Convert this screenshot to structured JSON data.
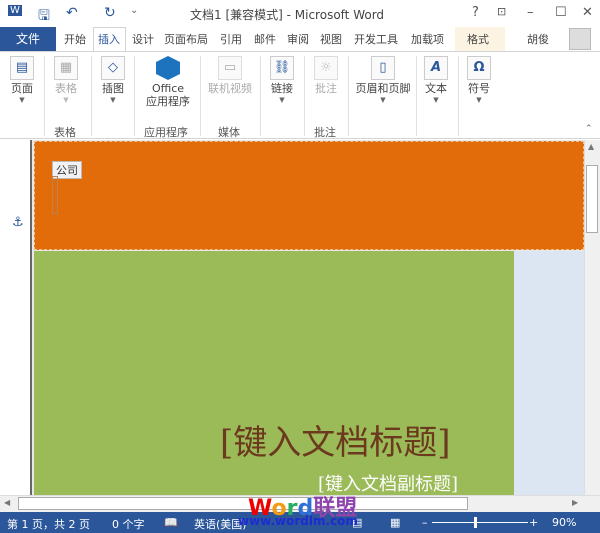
{
  "titlebar": {
    "title": "文档1 [兼容模式] - Microsoft Word",
    "help": "?",
    "restore_ribbon": "⊡",
    "minimize": "–",
    "maximize": "☐",
    "close": "✕"
  },
  "tabs": {
    "file": "文件",
    "items": [
      "开始",
      "插入",
      "设计",
      "页面布局",
      "引用",
      "邮件",
      "审阅",
      "视图",
      "开发工具",
      "加载项",
      "格式"
    ],
    "active": "插入",
    "user": "胡俊"
  },
  "ribbon": {
    "buttons": [
      {
        "label": "页面",
        "icon": "page-icon"
      },
      {
        "label": "表格",
        "icon": "table-icon",
        "disabled": true
      },
      {
        "label": "插图",
        "icon": "illustration-icon"
      },
      {
        "label": "Office\n应用程序",
        "icon": "office-apps-icon"
      },
      {
        "label": "联机视频",
        "icon": "video-icon",
        "disabled": true
      },
      {
        "label": "链接",
        "icon": "link-icon"
      },
      {
        "label": "批注",
        "icon": "comment-icon",
        "disabled": true
      },
      {
        "label": "页眉和页脚",
        "icon": "header-footer-icon"
      },
      {
        "label": "文本",
        "icon": "text-icon"
      },
      {
        "label": "符号",
        "icon": "symbol-icon"
      }
    ],
    "groups": [
      "表格",
      "应用程序",
      "媒体",
      "批注"
    ]
  },
  "document": {
    "company_label": "公司",
    "title_placeholder": "[键入文档标题]",
    "subtitle_placeholder": "[键入文档副标题]",
    "colors": {
      "header": "#e36c0a",
      "body": "#9bbb59",
      "side": "#dce6f2"
    }
  },
  "status": {
    "page": "第 1 页，共 2 页",
    "words": "0 个字",
    "language": "英语(美国)",
    "zoom": "90%",
    "zoom_percent": 90
  },
  "watermark": {
    "text": "Word联盟",
    "url": "www.wordlm.com"
  }
}
